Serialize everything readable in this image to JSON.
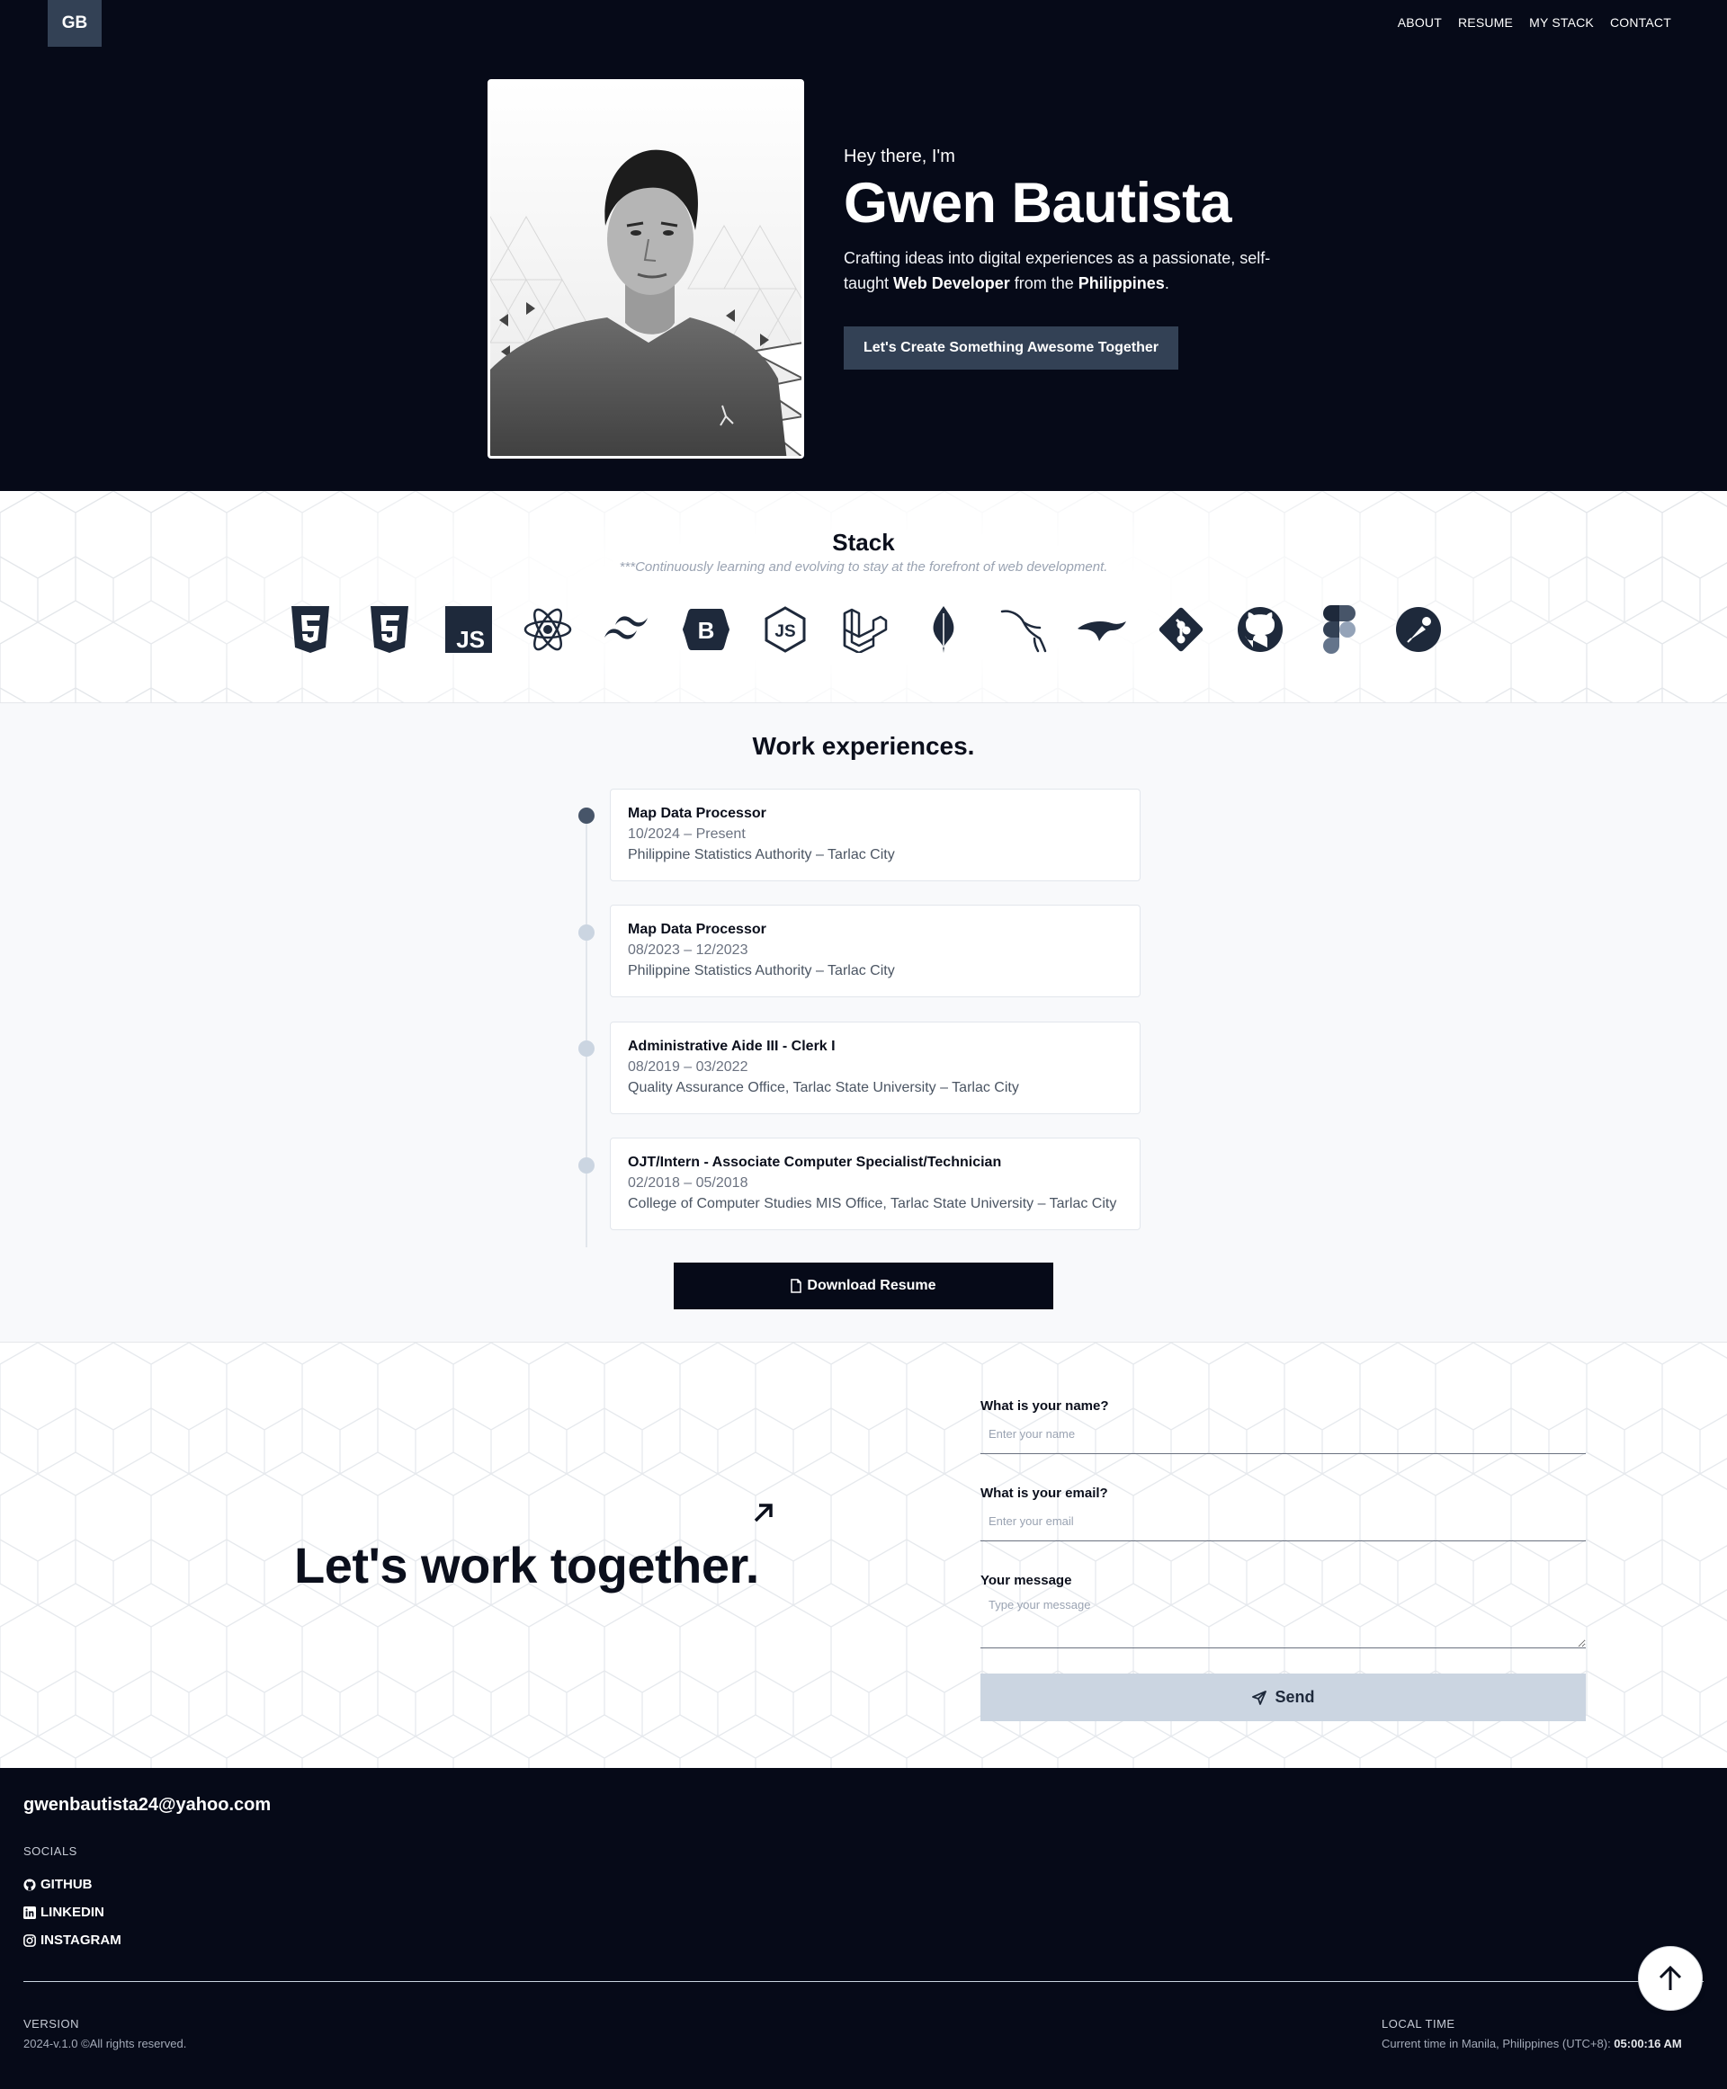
{
  "header": {
    "logo": "GB",
    "nav": [
      "ABOUT",
      "RESUME",
      "MY STACK",
      "CONTACT"
    ]
  },
  "hero": {
    "greeting": "Hey there, I'm",
    "name": "Gwen Bautista",
    "tagline_start": "Crafting ideas into digital experiences as a passionate, self-taught ",
    "tagline_bold1": "Web Developer",
    "tagline_mid": " from the ",
    "tagline_bold2": "Philippines",
    "tagline_end": ".",
    "cta": "Let's Create Something Awesome Together"
  },
  "stack": {
    "title": "Stack",
    "subtitle": "***Continuously learning and evolving to stay at the forefront of web development.",
    "icons": [
      "html5-icon",
      "css3-icon",
      "javascript-icon",
      "react-icon",
      "tailwind-icon",
      "bootstrap-icon",
      "nodejs-icon",
      "laravel-icon",
      "mongodb-icon",
      "mysql-icon",
      "mariadb-icon",
      "git-icon",
      "github-icon",
      "figma-icon",
      "postman-icon"
    ]
  },
  "work": {
    "title": "Work experiences.",
    "items": [
      {
        "role": "Map Data Processor",
        "dates": "10/2024 – Present",
        "org": "Philippine Statistics Authority – Tarlac City"
      },
      {
        "role": "Map Data Processor",
        "dates": "08/2023 – 12/2023",
        "org": "Philippine Statistics Authority – Tarlac City"
      },
      {
        "role": "Administrative Aide III - Clerk I",
        "dates": "08/2019 – 03/2022",
        "org": "Quality Assurance Office, Tarlac State University – Tarlac City"
      },
      {
        "role": "OJT/Intern - Associate Computer Specialist/Technician",
        "dates": "02/2018 – 05/2018",
        "org": "College of Computer Studies MIS Office, Tarlac State University – Tarlac City"
      }
    ],
    "download": "Download Resume"
  },
  "contact": {
    "heading": "Let's work together.",
    "name_label": "What is your name?",
    "name_placeholder": "Enter your name",
    "email_label": "What is your email?",
    "email_placeholder": "Enter your email",
    "message_label": "Your message",
    "message_placeholder": "Type your message",
    "send": "Send"
  },
  "footer": {
    "email": "gwenbautista24@yahoo.com",
    "socials_heading": "SOCIALS",
    "socials": [
      "GITHUB",
      "LINKEDIN",
      "INSTAGRAM"
    ],
    "version_heading": "VERSION",
    "version": "2024-v.1.0 ©All rights reserved.",
    "time_heading": "LOCAL TIME",
    "time_prefix": "Current time in Manila, Philippines (UTC+8): ",
    "time": "05:00:16 AM"
  },
  "colors": {
    "dark": "#060a18",
    "slate": "#334155",
    "muted": "#cbd5e1"
  }
}
